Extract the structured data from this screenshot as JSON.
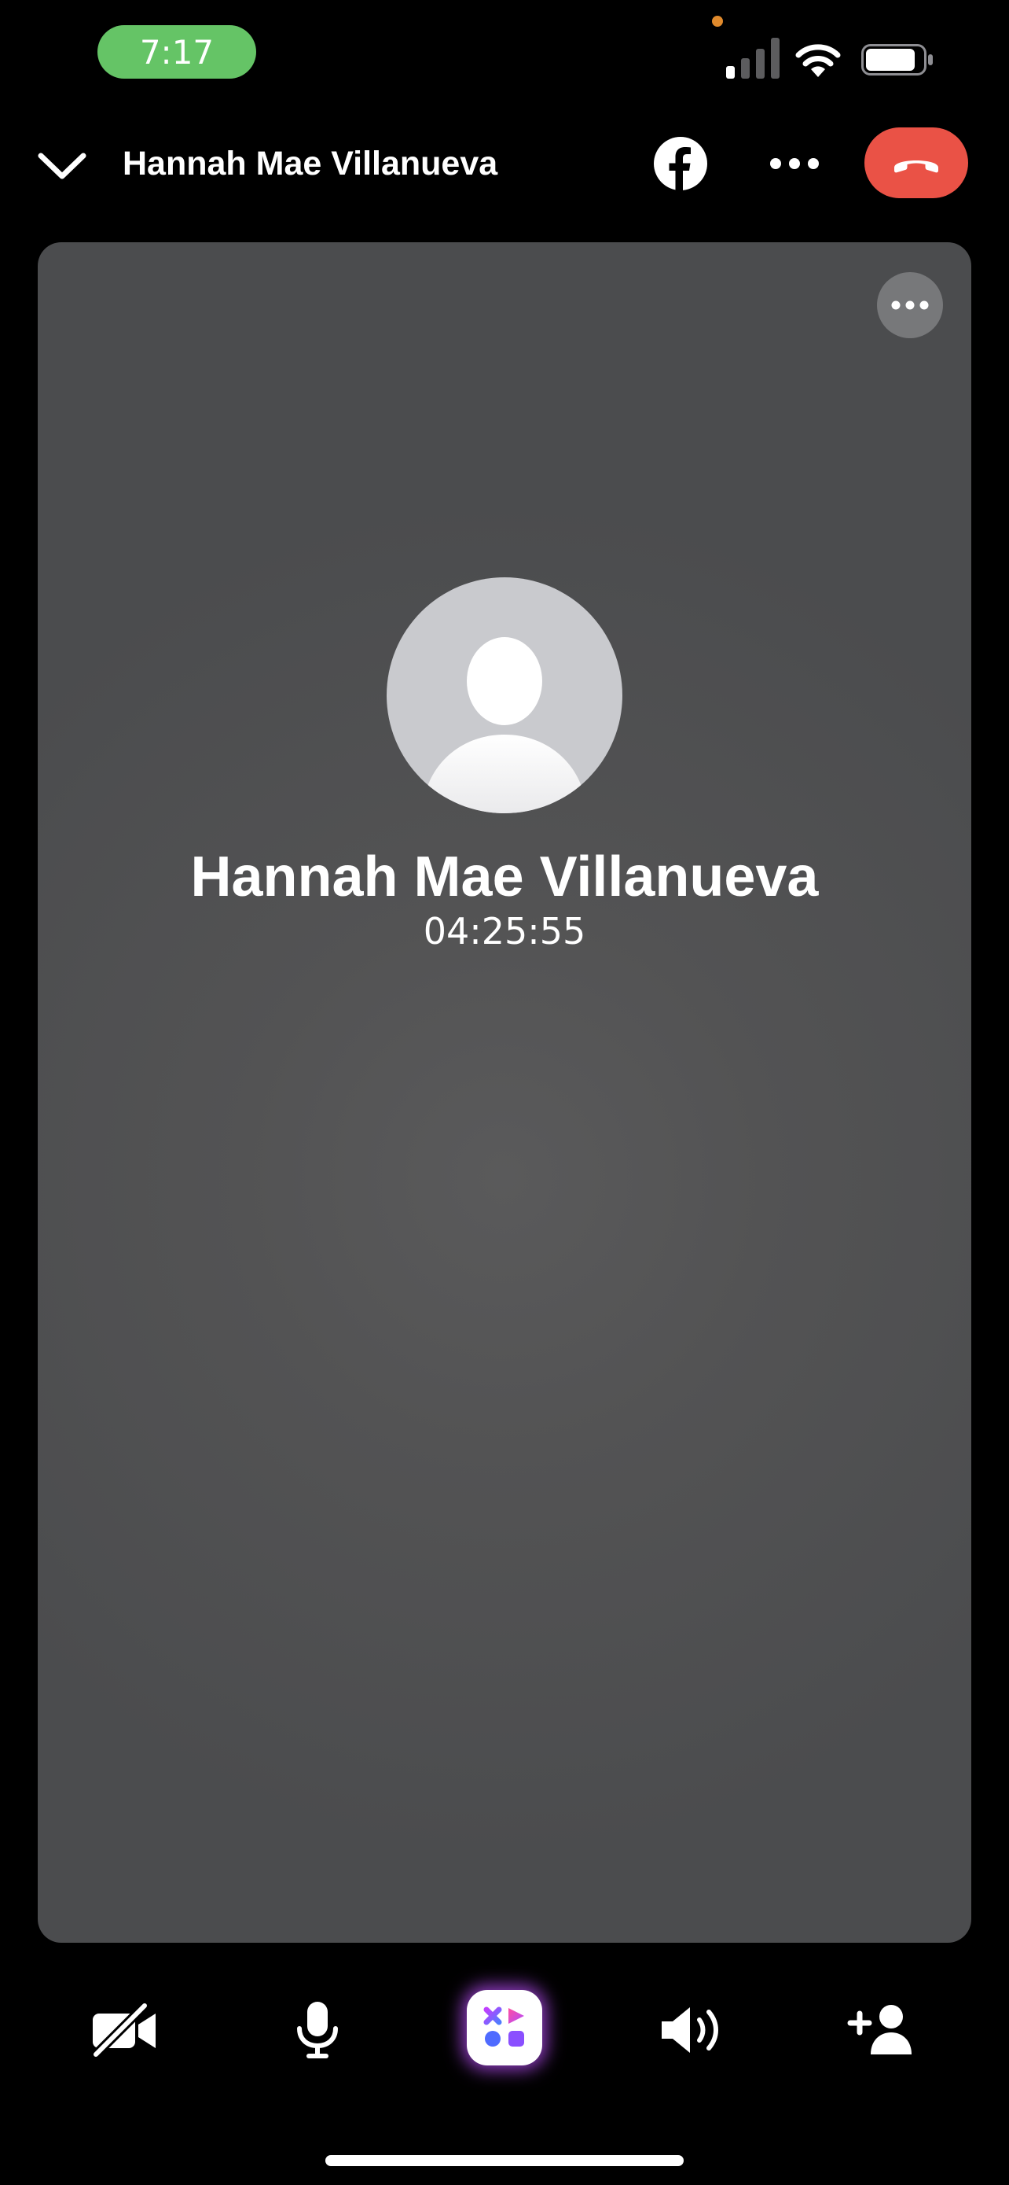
{
  "status_bar": {
    "time": "7:17",
    "colors": {
      "time_pill": "#65c466",
      "privacy_dot": "#e08a2c"
    },
    "icons": [
      "cellular-signal-icon",
      "wifi-icon",
      "battery-icon"
    ]
  },
  "header": {
    "title": "Hannah Mae Villanueva",
    "icons": [
      "chevron-down-icon",
      "facebook-icon",
      "more-horizontal-icon",
      "end-call-icon"
    ],
    "end_call_color": "#ea5246"
  },
  "call": {
    "name": "Hannah Mae Villanueva",
    "duration": "04:25:55",
    "tile_menu_icon": "more-horizontal-icon",
    "avatar_icon": "default-person-avatar-icon"
  },
  "controls": {
    "items": [
      {
        "name": "camera-off",
        "icon": "video-off-icon"
      },
      {
        "name": "microphone",
        "icon": "microphone-icon"
      },
      {
        "name": "effects",
        "icon": "effects-apps-icon"
      },
      {
        "name": "speaker",
        "icon": "speaker-icon"
      },
      {
        "name": "add-person",
        "icon": "add-person-icon"
      }
    ]
  }
}
